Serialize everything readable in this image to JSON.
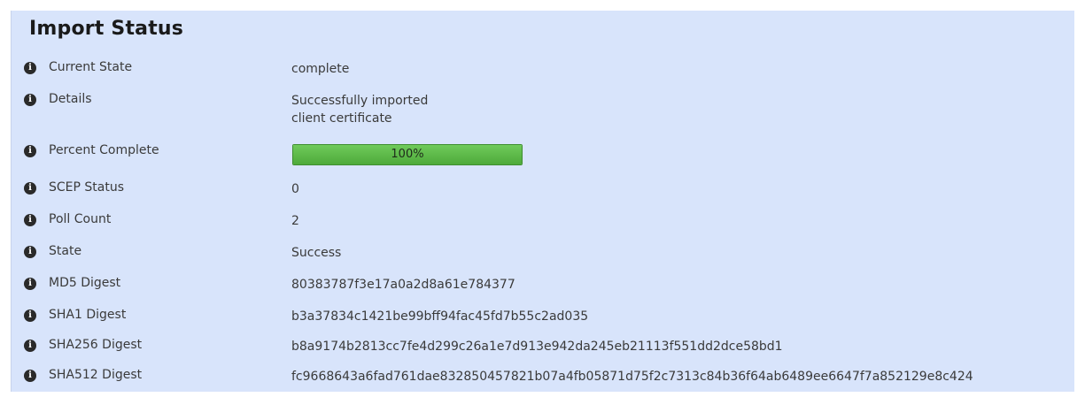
{
  "section": {
    "title": "Import Status"
  },
  "rows": [
    {
      "label": "Current State",
      "value": "complete"
    },
    {
      "label": "Details",
      "value_lines": [
        "Successfully imported",
        "client certificate"
      ]
    },
    {
      "label": "Percent Complete",
      "progress_text": "100%",
      "progress_fraction": 1.0
    },
    {
      "label": "SCEP Status",
      "value": "0"
    },
    {
      "label": "Poll Count",
      "value": "2"
    },
    {
      "label": "State",
      "value": "Success"
    },
    {
      "label": "MD5 Digest",
      "value": "80383787f3e17a0a2d8a61e784377"
    },
    {
      "label": "SHA1 Digest",
      "value": "b3a37834c1421be99bff94fac45fd7b55c2ad035"
    },
    {
      "label": "SHA256 Digest",
      "value": "b8a9174b2813cc7fe4d299c26a1e7d913e942da245eb21113f551dd2dce58bd1"
    },
    {
      "label": "SHA512 Digest",
      "value": "fc9668643a6fad761dae832850457821b07a4fb05871d75f2c7313c84b36f64ab6489ee6647f7a852129e8c424"
    }
  ],
  "icons": {
    "info": "info-icon"
  },
  "colors": {
    "panel_background": "#d8e4fb",
    "progress_green": "#4eaa3b"
  }
}
